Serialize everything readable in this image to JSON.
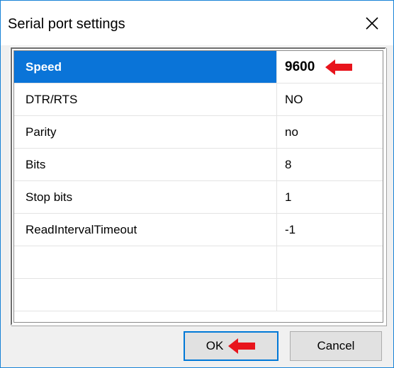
{
  "window": {
    "title": "Serial port settings"
  },
  "settings": {
    "rows": [
      {
        "name": "Speed",
        "value": "9600"
      },
      {
        "name": "DTR/RTS",
        "value": "NO"
      },
      {
        "name": "Parity",
        "value": "no"
      },
      {
        "name": "Bits",
        "value": "8"
      },
      {
        "name": "Stop bits",
        "value": "1"
      },
      {
        "name": "ReadIntervalTimeout",
        "value": "-1"
      },
      {
        "name": "",
        "value": ""
      },
      {
        "name": "",
        "value": ""
      }
    ],
    "selected_row": "Speed"
  },
  "buttons": {
    "ok_label": "OK",
    "cancel_label": "Cancel"
  },
  "colors": {
    "selection": "#0a74d8",
    "arrow": "#e8141c",
    "window_border": "#1883d7"
  },
  "icons": [
    "close-icon",
    "red-arrow-icon"
  ]
}
